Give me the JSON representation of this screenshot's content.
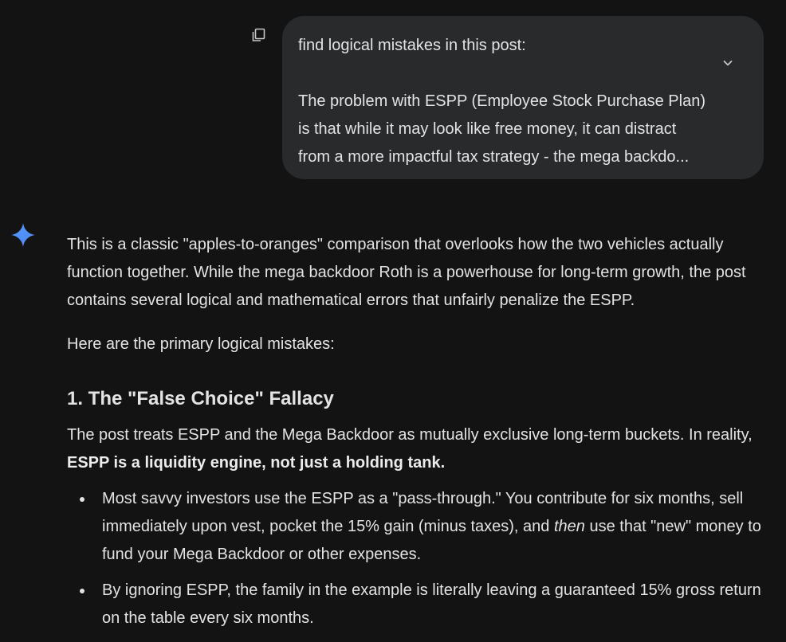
{
  "user_message": {
    "lines": [
      "find logical mistakes in this post:",
      "The problem with ESPP (Employee Stock Purchase Plan)",
      "is that while it may look like free money, it can distract",
      "from a more impactful tax strategy - the mega backdo..."
    ],
    "copy_icon": "copy-icon",
    "expand_icon": "chevron-down-icon"
  },
  "response": {
    "avatar_icon": "gemini-sparkle-icon",
    "intro": "This is a classic \"apples-to-oranges\" comparison that overlooks how the two vehicles actually function together. While the mega backdoor Roth is a powerhouse for long-term growth, the post contains several logical and mathematical errors that unfairly penalize the ESPP.",
    "lead": "Here are the primary logical mistakes:",
    "section1": {
      "heading": "1. The \"False Choice\" Fallacy",
      "para_start": "The post treats ESPP and the Mega Backdoor as mutually exclusive long-term buckets. In reality, ",
      "para_bold": "ESPP is a liquidity engine, not just a holding tank.",
      "bullet1_a": "Most savvy investors use the ESPP as a \"pass-through.\" You contribute for six months, sell immediately upon vest, pocket the 15% gain (minus taxes), and ",
      "bullet1_em": "then",
      "bullet1_b": " use that \"new\" money to fund your Mega Backdoor or other expenses.",
      "bullet2": "By ignoring ESPP, the family in the example is literally leaving a guaranteed 15% gross return on the table every six months."
    }
  },
  "colors": {
    "background": "#131314",
    "bubble": "#282a2c",
    "text": "#e3e3e3",
    "spark_gradient": [
      "#4f8cf7",
      "#5aa0ff",
      "#9b8cf6"
    ]
  }
}
